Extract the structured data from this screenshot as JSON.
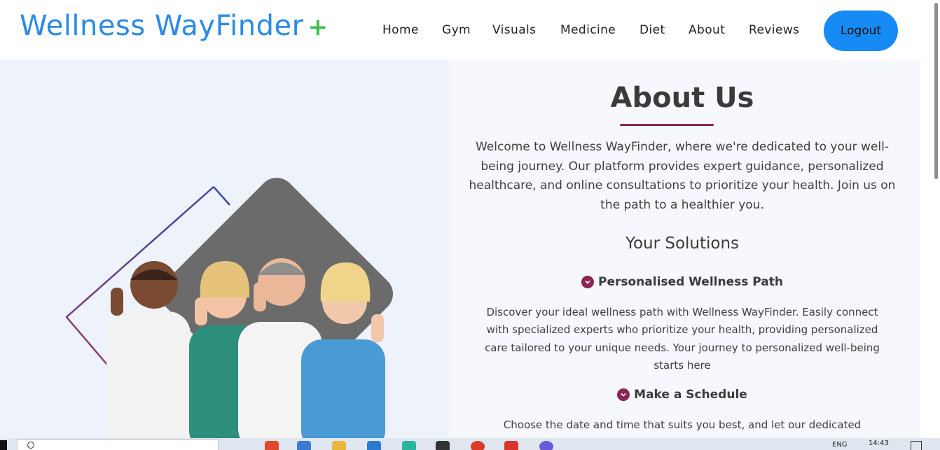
{
  "brand": {
    "name": "Wellness WayFinder",
    "plus": "+"
  },
  "nav": {
    "items": [
      "Home",
      "Gym",
      "Visuals",
      "Medicine",
      "Diet",
      "About",
      "Reviews"
    ],
    "logout": "Logout"
  },
  "about": {
    "title": "About Us",
    "paragraph": "Welcome to Wellness WayFinder, where we're dedicated to your well-being journey. Our platform provides expert guidance, personalized healthcare, and online consultations to prioritize your health. Join us on the path to a healthier you."
  },
  "solutions": {
    "heading": "Your Solutions",
    "items": [
      {
        "title": "Personalised Wellness Path",
        "desc": "Discover your ideal wellness path with Wellness WayFinder. Easily connect with specialized experts who prioritize your health, providing personalized care tailored to your unique needs. Your journey to personalized well-being starts here"
      },
      {
        "title": "Make a Schedule",
        "desc": "Choose the date and time that suits you best, and let our dedicated"
      }
    ]
  },
  "taskbar": {
    "time": "14:43",
    "lang": "ENG"
  },
  "colors": {
    "brand": "#2b8ae8",
    "plus": "#3ac24a",
    "accent": "#8d2553",
    "button": "#168bf5"
  }
}
